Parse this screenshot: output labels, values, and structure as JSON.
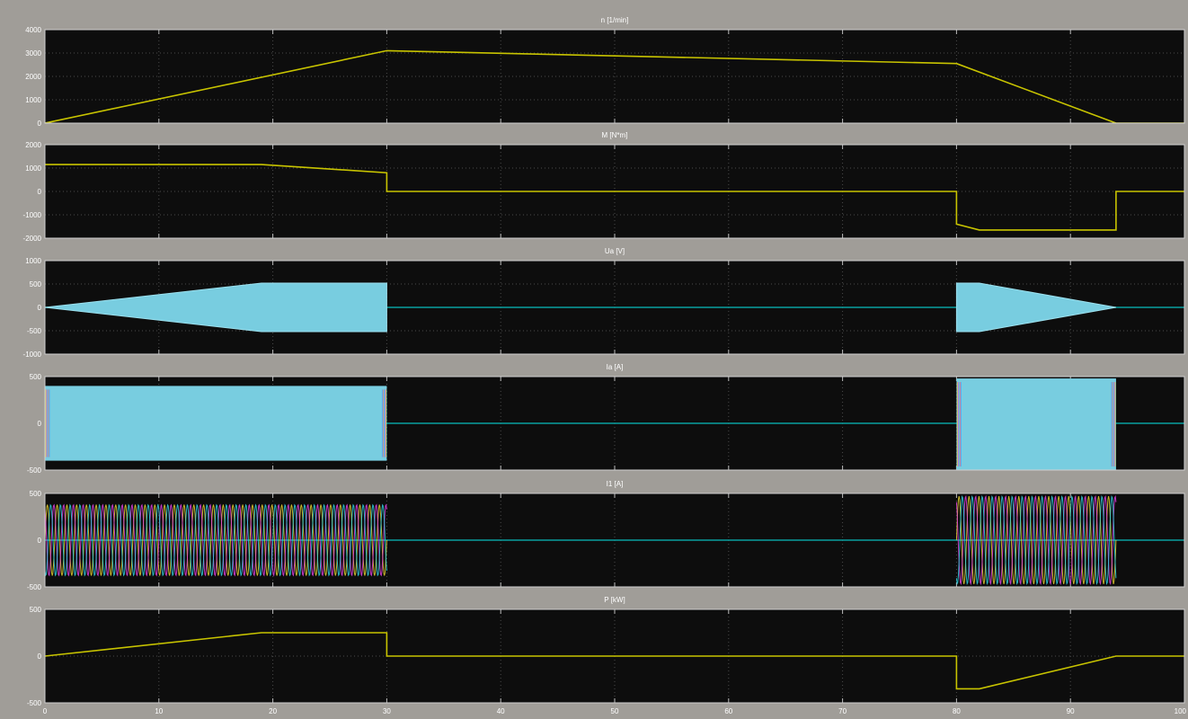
{
  "colors": {
    "figure_bg": "#a09d98",
    "axes_bg": "#0d0d0d",
    "grid": "#4a4a4a",
    "line": "#c8c400",
    "fill": "#78cde0",
    "zero_line": "#0aa0a0",
    "phase_colors": [
      "#e8d230",
      "#e040e0",
      "#30d0e0",
      "#ff6b6b",
      "#40a0ff"
    ]
  },
  "x_ticks": [
    "0",
    "10",
    "20",
    "30",
    "40",
    "50",
    "60",
    "70",
    "80",
    "90",
    "100"
  ],
  "chart_data": [
    {
      "type": "line",
      "title": "n [1/min]",
      "ylim": [
        0,
        4000
      ],
      "yticks": [
        "4000",
        "3000",
        "2000",
        "1000",
        "0"
      ],
      "xlim": [
        0,
        100
      ],
      "grid": true,
      "series": [
        {
          "x": [
            0,
            30,
            80,
            94,
            100
          ],
          "y": [
            0,
            3100,
            2550,
            0,
            0
          ]
        }
      ]
    },
    {
      "type": "line",
      "title": "M [N*m]",
      "ylim": [
        -2000,
        2000
      ],
      "yticks": [
        "2000",
        "1000",
        "0",
        "-1000",
        "-2000"
      ],
      "xlim": [
        0,
        100
      ],
      "grid": true,
      "series": [
        {
          "x": [
            0,
            19,
            30,
            30,
            80,
            80,
            82,
            94,
            94,
            100
          ],
          "y": [
            1150,
            1150,
            800,
            0,
            0,
            -1400,
            -1650,
            -1650,
            0,
            0
          ]
        }
      ]
    },
    {
      "type": "area",
      "title": "Ua [V]",
      "ylim": [
        -1000,
        1000
      ],
      "yticks": [
        "1000",
        "500",
        "0",
        "-500",
        "-1000"
      ],
      "xlim": [
        0,
        100
      ],
      "grid": true,
      "envelope": {
        "x": [
          0,
          19,
          30,
          80,
          82,
          94
        ],
        "upper": [
          0,
          520,
          520,
          520,
          520,
          0
        ]
      },
      "active_intervals": [
        [
          0,
          30
        ],
        [
          80,
          94
        ]
      ]
    },
    {
      "type": "area",
      "title": "Ia [A]",
      "ylim": [
        -500,
        500
      ],
      "yticks": [
        "500",
        "0",
        "-500"
      ],
      "xlim": [
        0,
        100
      ],
      "grid": true,
      "bands": [
        {
          "x": [
            0,
            30
          ],
          "upper": 400,
          "lower": -400
        },
        {
          "x": [
            80,
            94
          ],
          "upper": 480,
          "lower": -500
        }
      ]
    },
    {
      "type": "line",
      "title": "I1 [A]",
      "ylim": [
        -500,
        500
      ],
      "yticks": [
        "500",
        "0",
        "-500"
      ],
      "xlim": [
        0,
        100
      ],
      "grid": true,
      "oscillation": [
        {
          "x": [
            0,
            30
          ],
          "amplitude": 380
        },
        {
          "x": [
            80,
            94
          ],
          "amplitude": 470
        }
      ]
    },
    {
      "type": "line",
      "title": "P [kW]",
      "ylim": [
        -500,
        500
      ],
      "yticks": [
        "500",
        "0",
        "-500"
      ],
      "xlim": [
        0,
        100
      ],
      "grid": true,
      "series": [
        {
          "x": [
            0,
            19,
            30,
            30,
            80,
            80,
            82,
            94,
            100
          ],
          "y": [
            0,
            250,
            250,
            0,
            0,
            -350,
            -350,
            0,
            0
          ]
        }
      ]
    }
  ]
}
